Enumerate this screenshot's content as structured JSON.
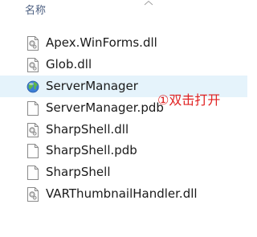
{
  "header": {
    "name_column": "名称"
  },
  "files": [
    {
      "name": "Apex.WinForms.dll",
      "icon": "dll-gear-file-icon",
      "selected": false
    },
    {
      "name": "Glob.dll",
      "icon": "dll-gear-file-icon",
      "selected": false
    },
    {
      "name": "ServerManager",
      "icon": "app-globe-icon",
      "selected": true
    },
    {
      "name": "ServerManager.pdb",
      "icon": "generic-file-icon",
      "selected": false
    },
    {
      "name": "SharpShell.dll",
      "icon": "dll-gear-file-icon",
      "selected": false
    },
    {
      "name": "SharpShell.pdb",
      "icon": "generic-file-icon",
      "selected": false
    },
    {
      "name": "SharpShell",
      "icon": "generic-file-icon",
      "selected": false
    },
    {
      "name": "VARThumbnailHandler.dll",
      "icon": "dll-gear-file-icon",
      "selected": false
    }
  ],
  "annotation": {
    "text": "①双击打开",
    "color": "#e02020"
  },
  "colors": {
    "selection": "#e5f3fb",
    "header_text": "#4d6082"
  }
}
